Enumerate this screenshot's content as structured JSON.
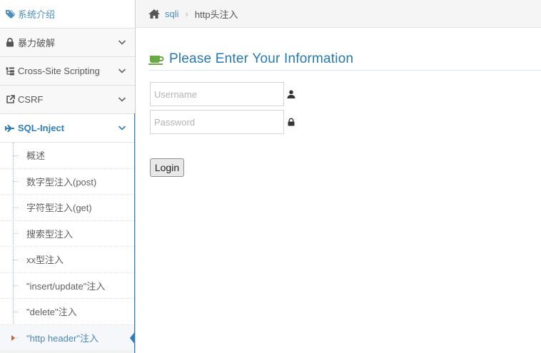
{
  "sidebar": {
    "items": [
      {
        "label": "系统介绍",
        "icon": "tags-icon"
      },
      {
        "label": "暴力破解",
        "icon": "lock-icon"
      },
      {
        "label": "Cross-Site Scripting",
        "icon": "sitemap-icon"
      },
      {
        "label": "CSRF",
        "icon": "share-icon"
      },
      {
        "label": "SQL-Inject",
        "icon": "plane-icon"
      }
    ],
    "submenu": [
      {
        "label": "概述"
      },
      {
        "label": "数字型注入(post)"
      },
      {
        "label": "字符型注入(get)"
      },
      {
        "label": "搜索型注入"
      },
      {
        "label": "xx型注入"
      },
      {
        "label": "\"insert/update\"注入"
      },
      {
        "label": "\"delete\"注入"
      },
      {
        "label": "\"http header\"注入"
      }
    ]
  },
  "breadcrumb": {
    "icon": "home-icon",
    "link": "sqli",
    "current": "http头注入"
  },
  "main": {
    "title": "Please Enter Your Information",
    "title_icon": "coffee-cup-icon",
    "username_placeholder": "Username",
    "password_placeholder": "Password",
    "login_label": "Login"
  },
  "colors": {
    "accent": "#2b7dbc",
    "link": "#4c8fbd",
    "cup_green": "#69aa46",
    "caret_orange": "#c86139"
  }
}
